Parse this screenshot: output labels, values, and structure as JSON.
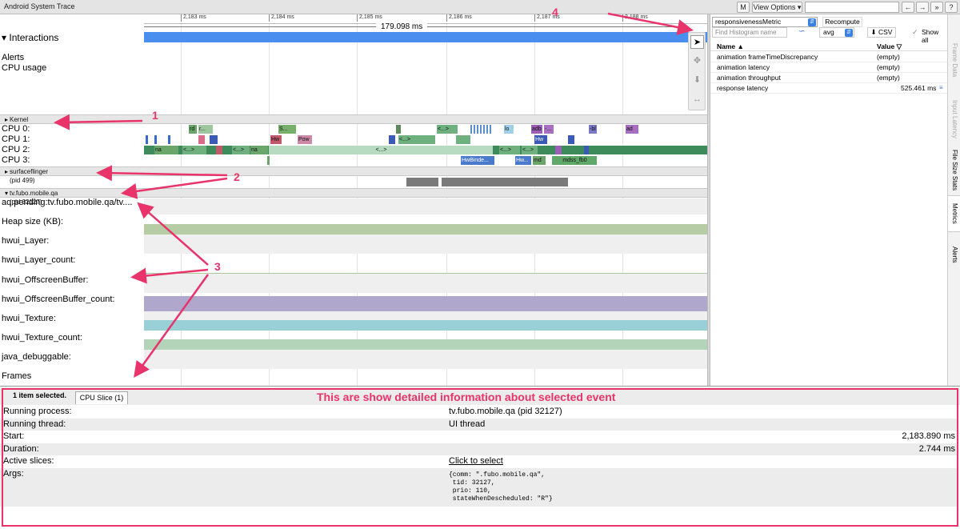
{
  "window": {
    "title": "Android System Trace"
  },
  "toolbar": {
    "m_label": "M",
    "view_options_label": "View Options ▾",
    "search_value": "",
    "prev_label": "←",
    "next_label": "→",
    "expand_label": "»",
    "help_label": "?"
  },
  "ruler": {
    "ticks": [
      "2,183 ms",
      "2,184 ms",
      "2,185 ms",
      "2,186 ms",
      "2,187 ms",
      "2,188 ms"
    ],
    "selection_duration": "179.098 ms"
  },
  "tracks": {
    "interactions": "Interactions",
    "alerts": "Alerts",
    "cpu_usage": "CPU usage",
    "kernel_header": "Kernel",
    "cpus": [
      "CPU 0:",
      "CPU 1:",
      "CPU 2:",
      "CPU 3:"
    ],
    "surfaceflinger_header": "surfaceflinger (pid 499)",
    "process_header": "tv.fubo.mobile.qa (pid 32127)",
    "counters": [
      "aq:pending:tv.fubo.mobile.qa/tv....",
      "Heap size (KB):",
      "hwui_Layer:",
      "hwui_Layer_count:",
      "hwui_OffscreenBuffer:",
      "hwui_OffscreenBuffer_count:",
      "hwui_Texture:",
      "hwui_Texture_count:",
      "java_debuggable:",
      "Frames"
    ]
  },
  "cpu_slices": {
    "cpu0": [
      "rd",
      "r...",
      "S...",
      "<...>",
      "lo",
      "adb",
      "-...",
      "-bl",
      "ad"
    ],
    "cpu1": [
      "Hw",
      "Pow",
      "<...>",
      "Hw"
    ],
    "cpu2": [
      "na",
      "<...>",
      "<...>",
      "na",
      "<...>",
      "<...>",
      "<...>"
    ],
    "cpu3": [
      "HwBinde...",
      "Hw...",
      "md",
      "mdss_fb0"
    ]
  },
  "right_panel": {
    "metric_select": "responsivenessMetric",
    "recompute_label": "Recompute",
    "find_histogram_placeholder": "Find Histogram name",
    "stat_select": "avg",
    "csv_label": "CSV",
    "show_all_label": "Show all",
    "col_name": "Name ▲",
    "col_value": "Value ▽",
    "rows": [
      {
        "name": "animation frameTimeDiscrepancy",
        "value": "(empty)"
      },
      {
        "name": "animation latency",
        "value": "(empty)"
      },
      {
        "name": "animation throughput",
        "value": "(empty)"
      },
      {
        "name": "response latency",
        "value": "525.461 ms"
      }
    ]
  },
  "side_tabs": [
    "Frame Data",
    "Input Latency",
    "File Size Stats",
    "Metrics",
    "Alerts"
  ],
  "bottom": {
    "selection_summary": "1 item selected.",
    "tab_label": "CPU Slice (1)",
    "rows": [
      {
        "key": "Running process:",
        "value": "tv.fubo.mobile.qa (pid 32127)"
      },
      {
        "key": "Running thread:",
        "value": "UI thread"
      },
      {
        "key": "Start:",
        "value": "2,183.890 ms"
      },
      {
        "key": "Duration:",
        "value": "2.744 ms"
      },
      {
        "key": "Active slices:",
        "value": "Click to select"
      },
      {
        "key": "Args:",
        "value": "{comm: \".fubo.mobile.qa\",\n tid: 32127,\n prio: 110,\n stateWhenDescheduled: \"R\"}"
      }
    ]
  },
  "annotations": {
    "n1": "1",
    "n2": "2",
    "n3": "3",
    "n4": "4",
    "caption": "This are show detailed information about selected event"
  },
  "colors": {
    "annotation": "#e8336b",
    "interaction_bar": "#4a8ff0",
    "heap_fill": "#b5cca5",
    "offscreen_fill": "#b0a7cc",
    "texture_fill": "#99cfd6",
    "texture_count_fill": "#b3d4b8"
  }
}
